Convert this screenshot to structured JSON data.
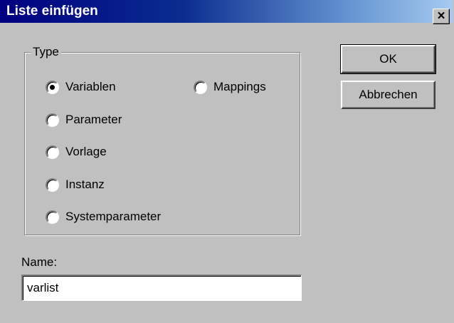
{
  "window": {
    "title": "Liste einfügen",
    "close_glyph": "×",
    "titlebar_color": "#000080"
  },
  "group": {
    "label": "Type",
    "options": [
      {
        "label": "Variablen",
        "selected": true
      },
      {
        "label": "Parameter",
        "selected": false
      },
      {
        "label": "Vorlage",
        "selected": false
      },
      {
        "label": "Instanz",
        "selected": false
      },
      {
        "label": "Systemparameter",
        "selected": false
      },
      {
        "label": "Mappings",
        "selected": false
      }
    ]
  },
  "buttons": {
    "ok_label": "OK",
    "cancel_label": "Abbrechen"
  },
  "name": {
    "label": "Name:",
    "value": "varlist"
  }
}
